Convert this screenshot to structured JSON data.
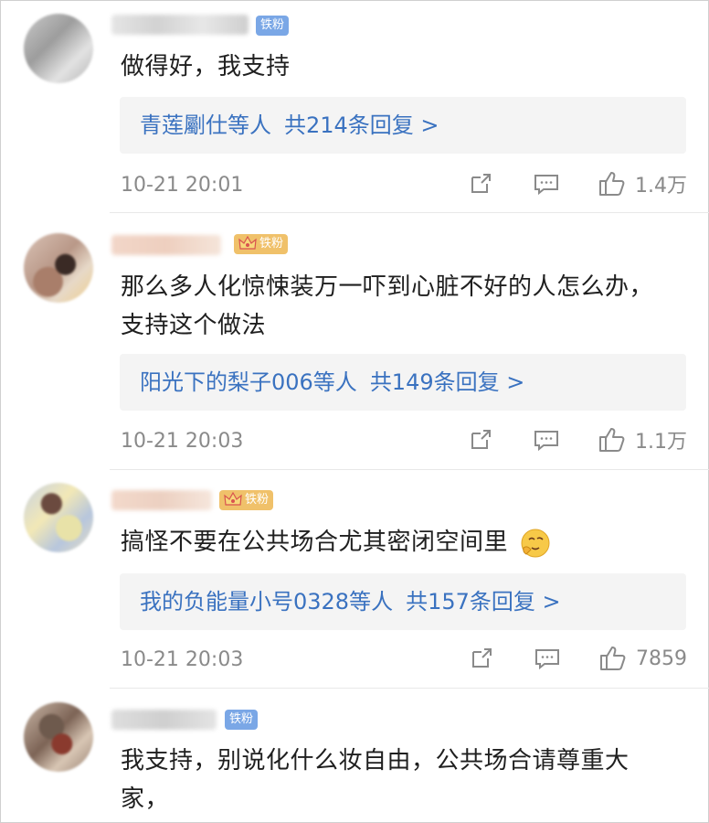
{
  "comments": [
    {
      "badge": "铁粉",
      "text": "做得好，我支持",
      "reply_users": "青莲劚仕等人",
      "reply_count": "共214条回复 >",
      "time": "10-21 20:01",
      "likes": "1.4万"
    },
    {
      "badge": "铁粉",
      "text_line1": "那么多人化惊悚装万一吓到心脏不好的人怎么办，",
      "text_line2": "支持这个做法",
      "reply_users": "阳光下的梨子006等人",
      "reply_count": "共149条回复 >",
      "time": "10-21 20:03",
      "likes": "1.1万"
    },
    {
      "badge": "铁粉",
      "text": "搞怪不要在公共场合尤其密闭空间里",
      "reply_users": "我的负能量小号0328等人",
      "reply_count": "共157条回复 >",
      "time": "10-21 20:03",
      "likes": "7859"
    },
    {
      "badge": "铁粉",
      "text_line1": "我支持，别说化什么妆自由，公共场合请尊重大",
      "text_line2": "家，"
    }
  ],
  "colors": {
    "link": "#3a72c0",
    "badge_blue": "#7aa7e6",
    "badge_gold": "#f0c16a"
  },
  "icons": [
    "share-icon",
    "comment-icon",
    "thumbs-up-icon",
    "crown-icon",
    "emoji-icon"
  ]
}
